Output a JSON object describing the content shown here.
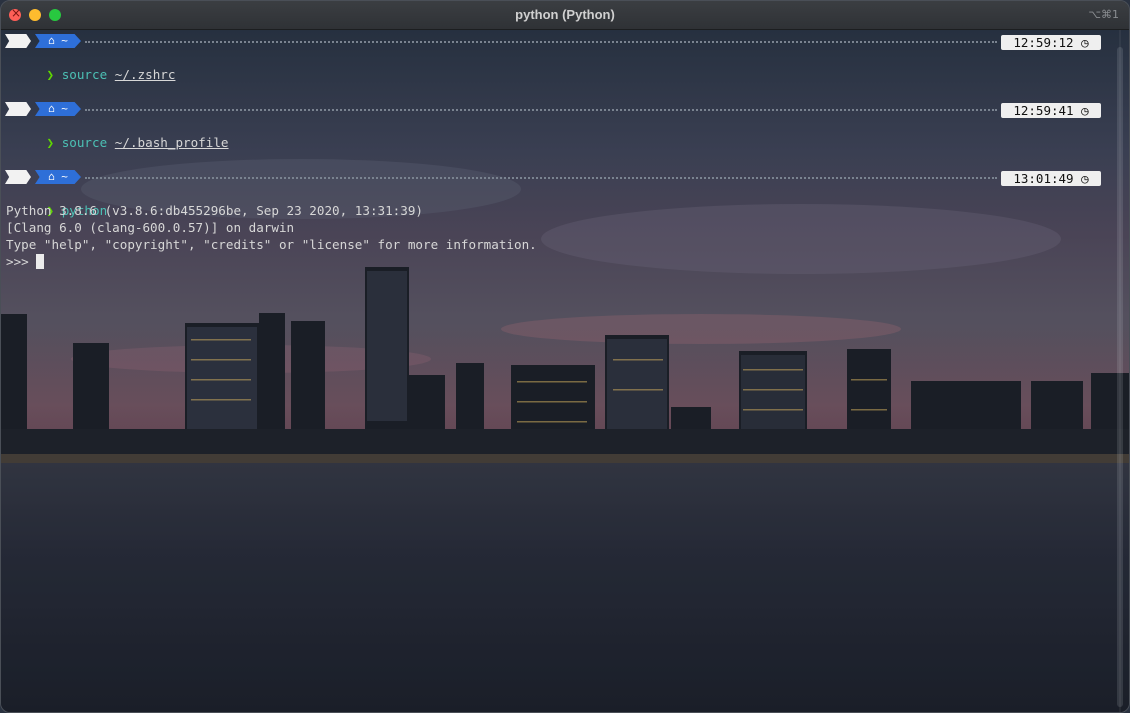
{
  "window": {
    "title": "python (Python)",
    "shortcut": "⌥⌘1"
  },
  "prompt_blocks": [
    {
      "apple_glyph": "",
      "home_label": "⌂ ~",
      "time": "12:59:12 ◷",
      "prompt_char": "❯",
      "command": "source",
      "argument": "~/.zshrc"
    },
    {
      "apple_glyph": "",
      "home_label": "⌂ ~",
      "time": "12:59:41 ◷",
      "prompt_char": "❯",
      "command": "source",
      "argument": "~/.bash_profile"
    },
    {
      "apple_glyph": "",
      "home_label": "⌂ ~",
      "time": "13:01:49 ◷",
      "prompt_char": "❯",
      "command": "python",
      "argument": ""
    }
  ],
  "python_output": [
    "Python 3.8.6 (v3.8.6:db455296be, Sep 23 2020, 13:31:39)",
    "[Clang 6.0 (clang-600.0.57)] on darwin",
    "Type \"help\", \"copyright\", \"credits\" or \"license\" for more information."
  ],
  "repl_prompt": ">>> ",
  "icons": {
    "close": "close-icon",
    "minimize": "minimize-icon",
    "maximize": "maximize-icon",
    "apple": "apple-icon",
    "home": "home-icon",
    "clock": "clock-icon"
  },
  "colors": {
    "prompt_green": "#5fd700",
    "command_teal": "#4cc0b5",
    "home_segment_blue": "#2e6fd8",
    "time_bg": "#efefef"
  }
}
